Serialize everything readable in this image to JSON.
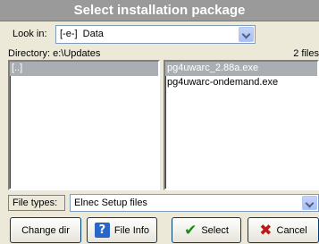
{
  "window": {
    "title": "Select installation package"
  },
  "look_in": {
    "label": "Look in:",
    "value": "[-e-]  Data"
  },
  "directory": {
    "label": "Directory: e:\\Updates",
    "files_count": "2 files"
  },
  "dir_list": {
    "items": [
      "[..]"
    ],
    "selected_index": 0
  },
  "file_list": {
    "items": [
      "pg4uwarc_2.88a.exe",
      "pg4uwarc-ondemand.exe"
    ],
    "selected_index": 0
  },
  "file_types": {
    "label": "File types:",
    "value": "Elnec Setup files"
  },
  "buttons": {
    "change_dir": "Change dir",
    "file_info": "File Info",
    "select": "Select",
    "cancel": "Cancel"
  },
  "icons": {
    "file_info": "help-icon",
    "select": "checkmark-icon",
    "cancel": "x-icon"
  },
  "colors": {
    "title_bg": "#9a9a9a",
    "selection_bg": "#a9aeb2",
    "help_blue": "#2a66c9",
    "check_green": "#1d8a1d",
    "cancel_red": "#c01818"
  }
}
